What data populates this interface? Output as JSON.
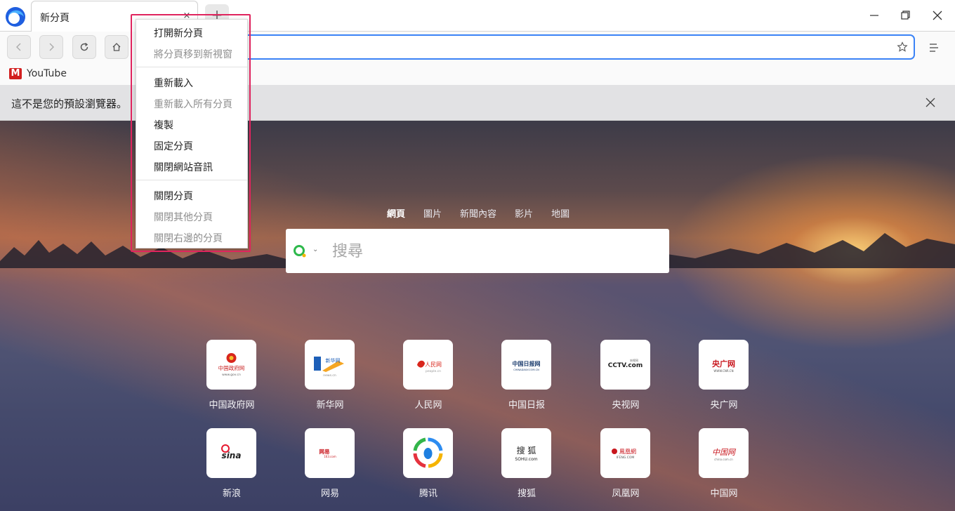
{
  "tab": {
    "title": "新分頁",
    "close_symbol": "×",
    "new_tab_symbol": "+"
  },
  "address": {
    "value": "",
    "placeholder": ""
  },
  "bookmarks": [
    {
      "icon": "M",
      "label": "YouTube"
    }
  ],
  "infobar": {
    "text": "這不是您的預設瀏覽器。"
  },
  "search": {
    "tabs": [
      "網頁",
      "圖片",
      "新聞內容",
      "影片",
      "地圖"
    ],
    "active_tab": "網頁",
    "placeholder": "搜尋",
    "caret": "⌄"
  },
  "sites_row1": [
    {
      "name": "中国政府网",
      "logo_text": "中国政府网",
      "logo_sub": "www.gov.cn"
    },
    {
      "name": "新华网",
      "logo_text": "新华网",
      "logo_sub": "news.cn"
    },
    {
      "name": "人民网",
      "logo_text": "人民网",
      "logo_sub": "people.cn"
    },
    {
      "name": "中国日报",
      "logo_text": "中国日报网",
      "logo_sub": "CHINADAILY.COM.CN"
    },
    {
      "name": "央视网",
      "logo_text": "CCTV.com",
      "logo_sub": "央视网"
    },
    {
      "name": "央广网",
      "logo_text": "央广网",
      "logo_sub": "WWW.CNR.CN"
    }
  ],
  "sites_row2": [
    {
      "name": "新浪",
      "logo_text": "sina",
      "logo_sub": ""
    },
    {
      "name": "网易",
      "logo_text": "网易",
      "logo_sub": "163.com"
    },
    {
      "name": "腾讯",
      "logo_text": "",
      "logo_sub": ""
    },
    {
      "name": "搜狐",
      "logo_text": "搜 狐",
      "logo_sub": "SOHU.com"
    },
    {
      "name": "凤凰网",
      "logo_text": "鳳凰網",
      "logo_sub": "IFENG.COM"
    },
    {
      "name": "中国网",
      "logo_text": "中国网",
      "logo_sub": "china.com.cn"
    }
  ],
  "context_menu": {
    "group1": [
      {
        "label": "打開新分頁",
        "enabled": true
      },
      {
        "label": "將分頁移到新視窗",
        "enabled": false
      }
    ],
    "group2": [
      {
        "label": "重新載入",
        "enabled": true
      },
      {
        "label": "重新載入所有分頁",
        "enabled": false
      },
      {
        "label": "複製",
        "enabled": true
      },
      {
        "label": "固定分頁",
        "enabled": true
      },
      {
        "label": "關閉網站音訊",
        "enabled": true
      }
    ],
    "group3": [
      {
        "label": "關閉分頁",
        "enabled": true
      },
      {
        "label": "關閉其他分頁",
        "enabled": false
      },
      {
        "label": "關閉右邊的分頁",
        "enabled": false
      }
    ]
  },
  "colors": {
    "accent": "#3b83f6",
    "highlight": "#e0245e",
    "youtube": "#d21f1f"
  }
}
